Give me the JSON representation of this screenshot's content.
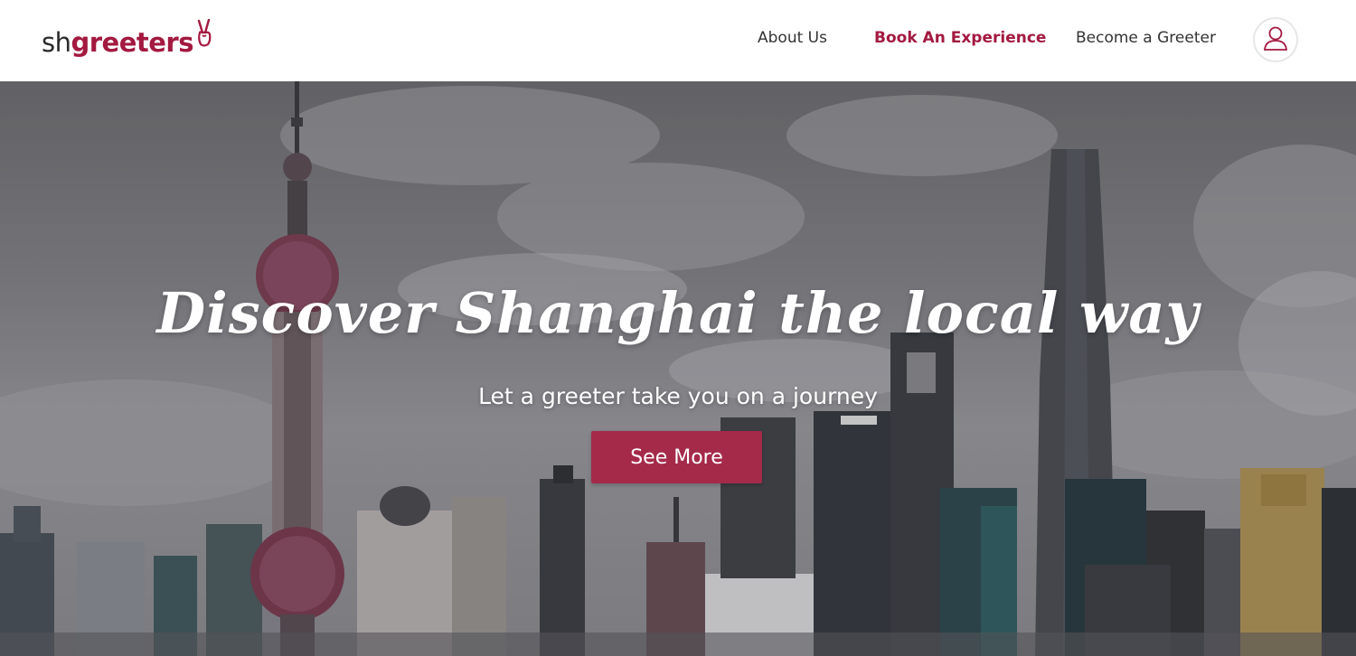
{
  "brand": {
    "prefix": "sh",
    "name": "greeters",
    "accent_color": "#a3193f",
    "logo_icon": "peace-hand-icon"
  },
  "nav": {
    "items": [
      {
        "label": "About Us",
        "active": false
      },
      {
        "label": "Book An Experience",
        "active": true
      },
      {
        "label": "Become a Greeter",
        "active": false
      }
    ],
    "profile_icon": "user-icon"
  },
  "hero": {
    "title": "Discover Shanghai the local way",
    "subtitle": "Let a greeter take you on a journey",
    "cta_label": "See More",
    "cta_color": "#a52a4a"
  }
}
